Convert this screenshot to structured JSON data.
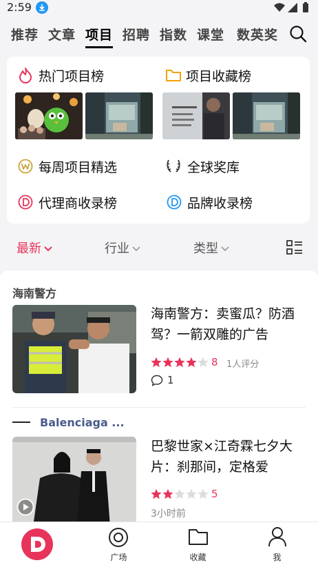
{
  "status": {
    "time": "2:59"
  },
  "tabs": [
    {
      "label": "推荐"
    },
    {
      "label": "文章"
    },
    {
      "label": "项目",
      "active": true
    },
    {
      "label": "招聘"
    },
    {
      "label": "指数"
    },
    {
      "label": "课堂"
    },
    {
      "label": "数英奖"
    }
  ],
  "rankings": {
    "hot_title": "热门项目榜",
    "fav_title": "项目收藏榜",
    "weekly": "每周项目精选",
    "awards": "全球奖库",
    "agency": "代理商收录榜",
    "brand": "品牌收录榜"
  },
  "filters": {
    "latest": "最新",
    "industry": "行业",
    "type": "类型"
  },
  "articles": [
    {
      "source": "海南警方",
      "title_line1": "海南警方：卖蜜瓜？防酒",
      "title_line2": "驾？一箭双雕的广告",
      "rating": 8,
      "stars_filled": 4,
      "rating_count": "1人评分",
      "comments": "1"
    },
    {
      "source": "Balenciaga ...",
      "title_line1": "巴黎世家×江奇霖七夕大",
      "title_line2": "片：刹那间，定格爱",
      "rating": 5,
      "stars_filled": 2.5,
      "time": "3小时前"
    }
  ],
  "bottom_nav": [
    {
      "label": ""
    },
    {
      "label": "广场"
    },
    {
      "label": "收藏"
    },
    {
      "label": "我"
    }
  ],
  "colors": {
    "accent": "#e8345a",
    "active_tab": "#000000",
    "brand_blue": "#2196f3"
  }
}
